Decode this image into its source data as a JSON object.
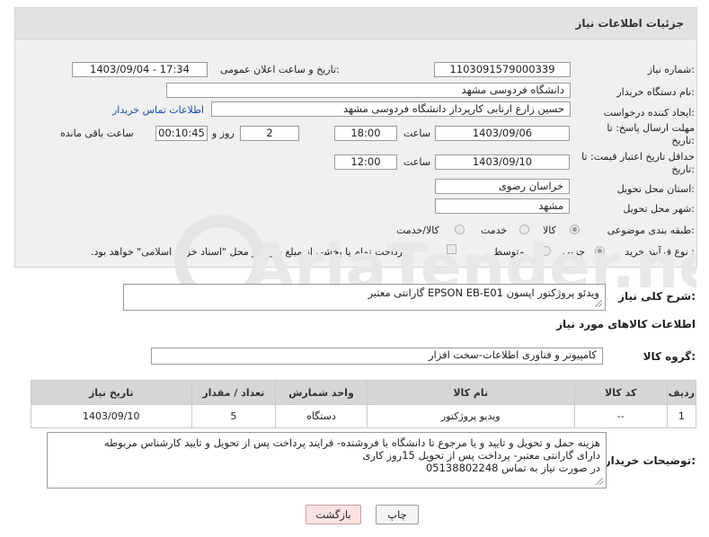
{
  "header": {
    "title": "جزئیات اطلاعات نیاز"
  },
  "form": {
    "need_number": {
      "label": "شماره نیاز:",
      "value": "1103091579000339"
    },
    "announce_datetime": {
      "label": "تاریخ و ساعت اعلان عمومی:",
      "value": "1403/09/04 - 17:34"
    },
    "buyer_org": {
      "label": "نام دستگاه خریدار:",
      "value": "دانشگاه فردوسی مشهد"
    },
    "requester": {
      "label": "ایجاد کننده درخواست:",
      "value": "حسین زارع ارنابی کارپرداز دانشگاه فردوسی مشهد",
      "contact_link": "اطلاعات تماس خریدار"
    },
    "reply_deadline": {
      "label_line1": "مهلت ارسال پاسخ: تا",
      "label_line2": "تاریخ:",
      "date": "1403/09/06",
      "time_label": "ساعت",
      "time": "18:00",
      "days": "2",
      "days_label": "روز و",
      "remaining": "00:10:45",
      "remaining_label": "ساعت باقی مانده"
    },
    "price_validity": {
      "label_line1": "حداقل تاریخ اعتبار قیمت: تا",
      "label_line2": "تاریخ:",
      "date": "1403/09/10",
      "time_label": "ساعت",
      "time": "12:00"
    },
    "province": {
      "label": "استان محل تحویل:",
      "value": "خراسان رضوی"
    },
    "city": {
      "label": "شهر محل تحویل:",
      "value": "مشهد"
    },
    "category": {
      "label": "طبقه بندی موضوعی:",
      "options": [
        "کالا",
        "خدمت",
        "کالا/خدمت"
      ],
      "selected": "کالا"
    },
    "purchase_process": {
      "label": "نوع فرآیند خرید :",
      "options": [
        "جزیی",
        "متوسط"
      ],
      "selected": "جزیی",
      "note": "پرداخت تمام یا بخشی از مبلغ خرید،از محل \"اسناد خزانه اسلامی\" خواهد بود."
    }
  },
  "summary": {
    "label": "شرح کلی نیاز:",
    "value": "ویدئو پروژکتور اپسون EPSON EB-E01 گارانتی معتبر"
  },
  "goods_section": {
    "title": "اطلاعات کالاهای مورد نیاز"
  },
  "goods_group": {
    "label": "گروه کالا:",
    "value": "کامپیوتر و فناوری اطلاعات-سخت افزار"
  },
  "items_table": {
    "headers": [
      "ردیف",
      "کد کالا",
      "نام کالا",
      "واحد شمارش",
      "تعداد / مقدار",
      "تاریخ نیاز"
    ],
    "rows": [
      [
        "1",
        "--",
        "ویدیو پروژکتور",
        "دستگاه",
        "5",
        "1403/09/10"
      ]
    ]
  },
  "buyer_notes": {
    "label": "توضیحات خریدار:",
    "lines": [
      "هزینه حمل و تحویل و تایید و یا مرجوع تا دانشگاه با فروشنده- فرایند پرداخت پس از تحویل و تایید کارشناس مربوطه",
      "دارای گارانتی معتبر- پرداخت پس از تحویل 15روز کاری",
      "در صورت نیاز به تماس 05138802248"
    ]
  },
  "buttons": {
    "print": "چاپ",
    "back": "بازگشت"
  },
  "watermark": {
    "text": "AriaTender.neT"
  }
}
